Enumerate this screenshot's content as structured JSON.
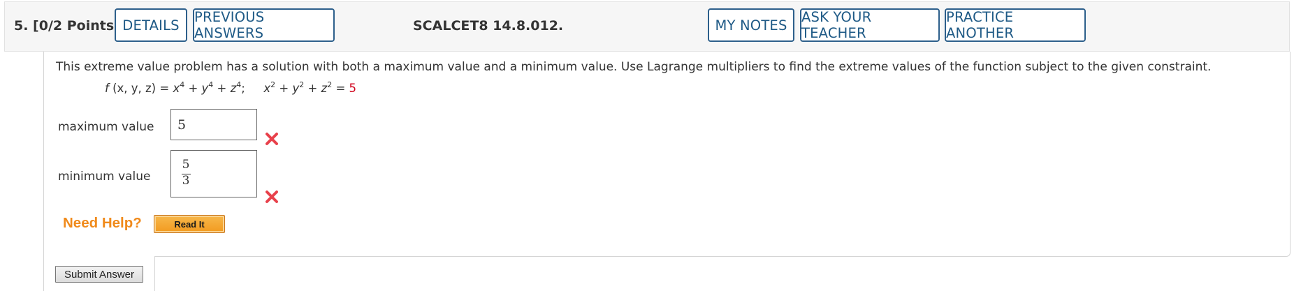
{
  "header": {
    "question_label": "5.  [0/2 Points]",
    "buttons": {
      "details": "DETAILS",
      "previous_answers": "PREVIOUS ANSWERS",
      "my_notes": "MY NOTES",
      "ask_teacher": "ASK YOUR TEACHER",
      "practice_another": "PRACTICE ANOTHER"
    },
    "reference": "SCALCET8 14.8.012."
  },
  "problem": {
    "prompt": "This extreme value problem has a solution with both a maximum value and a minimum value. Use Lagrange multipliers to find the extreme values of the function subject to the given constraint.",
    "function": {
      "name": "f",
      "args": "(x, y, z)",
      "equals": "=",
      "t1_base": "x",
      "t1_exp": "4",
      "plus1": "+",
      "t2_base": "y",
      "t2_exp": "4",
      "plus2": "+",
      "t3_base": "z",
      "t3_exp": "4",
      "sep": ";"
    },
    "constraint": {
      "t1_base": "x",
      "t1_exp": "2",
      "plus1": "+",
      "t2_base": "y",
      "t2_exp": "2",
      "plus2": "+",
      "t3_base": "z",
      "t3_exp": "2",
      "equals": "=",
      "value": "5"
    }
  },
  "answers": {
    "maximum": {
      "label": "maximum value",
      "value": "5",
      "status": "incorrect"
    },
    "minimum": {
      "label": "minimum value",
      "numerator": "5",
      "denominator": "3",
      "status": "incorrect"
    }
  },
  "help": {
    "label": "Need Help?",
    "read_it": "Read It"
  },
  "submit_label": "Submit Answer",
  "colors": {
    "button_border": "#2d5f8b",
    "button_text": "#1f5a86",
    "wrong_mark": "#e8414b",
    "help_text": "#f08a1b",
    "constraint_value": "#d0021b"
  }
}
